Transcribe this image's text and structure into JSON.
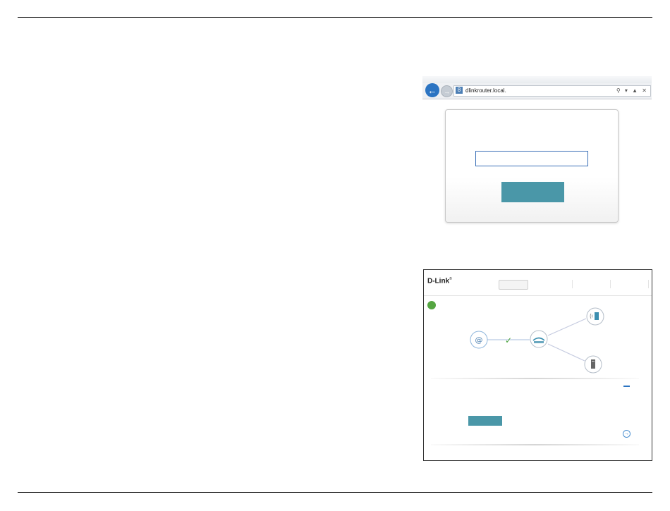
{
  "browser": {
    "url": "dlinkrouter.local.",
    "back_glyph": "←",
    "forward_glyph": "→",
    "site_icon_glyph": "8",
    "address_icons": "⚲ ▾ ▲ ✕"
  },
  "login": {
    "password_value": "",
    "button_label": ""
  },
  "router": {
    "logo": "D-Link",
    "logo_mark": "®",
    "tabs": [
      ""
    ],
    "status_color": "#55a642",
    "icons": {
      "internet": "internet-icon",
      "router": "router-icon",
      "wireless_client": "wireless-client-icon",
      "wired_client": "wired-client-icon"
    },
    "connected_glyph": "✓",
    "settings_button_label": "",
    "arrow_glyph": "→"
  },
  "colors": {
    "accent_teal": "#4a97a8",
    "browser_blue": "#2b74c2",
    "status_green": "#55a642"
  }
}
